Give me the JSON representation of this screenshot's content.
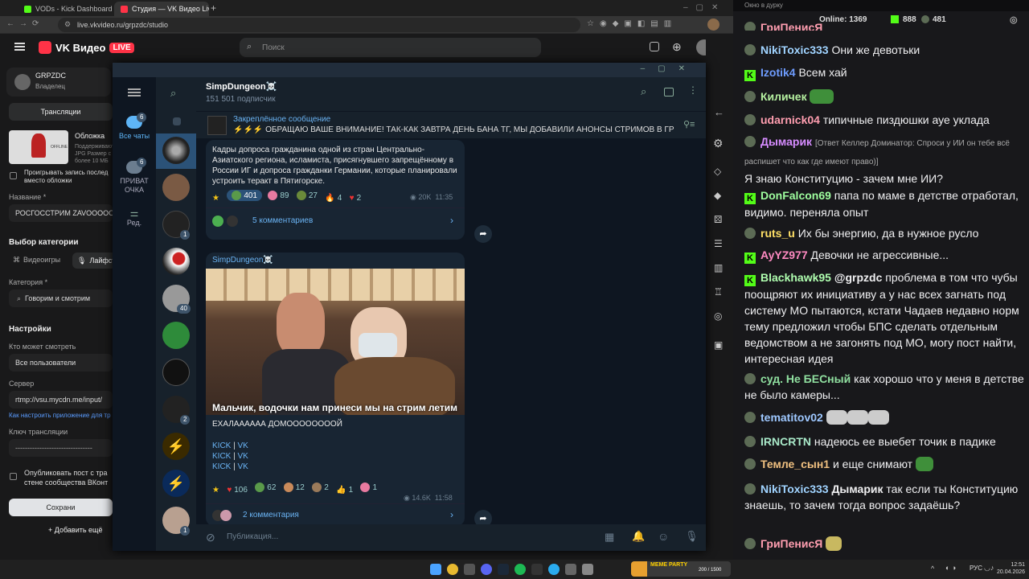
{
  "browser": {
    "tabs": [
      {
        "label": "VODs - Kick Dashboard",
        "color": "#53fc18"
      },
      {
        "label": "Студия — VK Видео Live",
        "color": "#ff3347"
      }
    ],
    "url": "live.vkvideo.ru/grpzdc/studio"
  },
  "vk": {
    "logo": "VK Видео",
    "live_badge": "LIVE",
    "search_placeholder": "Поиск",
    "user_name": "GRPZDC",
    "user_role": "Владелец",
    "nav_broadcasts": "Трансляции",
    "cover_label": "Обложка",
    "cover_hint_1": "Поддерживаются",
    "cover_hint_2": "JPG Размер с",
    "cover_hint_3": "более 10 МБ",
    "cover_tag": "OFFLINE",
    "replay_label": "Проигрывать запись послед",
    "replay_label_2": "вместо обложки",
    "name_label": "Название *",
    "name_value": "РОСГОССТРИМ ZAVOOOOO2",
    "category_section": "Выбор категории",
    "cat_games": "Видеоигры",
    "cat_life": "Лайфст",
    "category_label": "Категория *",
    "category_value": "Говорим и смотрим",
    "settings_section": "Настройки",
    "who_can_watch": "Кто может смотреть",
    "who_value": "Все пользователи",
    "server_label": "Сервер",
    "server_value": "rtmp://vsu.mycdn.me/input/",
    "howto_link": "Как настроить приложение для тр",
    "key_label": "Ключ трансляции",
    "key_value": "--------------------------------",
    "publish_label": "Опубликовать пост с тра",
    "publish_label_2": "стене сообщества ВКонт",
    "save_button": "Сохрани",
    "add_button": "Добавить ещё"
  },
  "tg": {
    "channel": "SimpDungeon☠️",
    "subscribers": "151 501 подписчик",
    "folders": [
      {
        "label": "Все чаты",
        "badge": "6"
      },
      {
        "label": "ПРИВАТ ОЧКА",
        "badge": "6"
      },
      {
        "label": "Ред.",
        "badge": ""
      }
    ],
    "chat_badges": [
      "1",
      "40",
      "2",
      "1"
    ],
    "pinned_title": "Закреплённое сообщение",
    "pinned_text": "⚡⚡⚡ ОБРАЩАЮ ВАШЕ ВНИМАНИЕ!  ТАК-КАК ЗАВТРА ДЕНЬ БАНА ТГ, МЫ ДОБАВИЛИ АНОНСЫ СТРИМОВ В ГРУП...",
    "post1": {
      "text": "Кадры допроса гражданина одной из стран Центрально-Азиатского региона, исламиста, присягнувшего запрещённому в России ИГ и допроса гражданки Германии, которые планировали устроить теракт в Пятигорске.",
      "reactions": [
        "401",
        "89",
        "27",
        "4",
        "2"
      ],
      "views": "20K",
      "time": "11:35",
      "comments": "5 комментариев"
    },
    "post2": {
      "author": "SimpDungeon☠️",
      "caption": "Мальчик, водочки нам принеси  мы на стрим летим",
      "text": "ЕХАЛАААААА ДОМООООООООЙ",
      "links": [
        "KICK",
        "VK",
        "KICK",
        "VK",
        "KICK",
        "VK"
      ],
      "reactions": [
        "106",
        "62",
        "12",
        "2",
        "1",
        "1"
      ],
      "views": "14.6K",
      "time": "11:58",
      "comments": "2 комментария"
    },
    "composer_placeholder": "Публикация..."
  },
  "chat": {
    "window_title": "Окно в дурку",
    "online": "Online: 1369",
    "kick_count": "888",
    "vk_count": "481",
    "messages": [
      {
        "name": "ГриПенисЯ",
        "color": "#fff",
        "text": "[partially visible]"
      },
      {
        "name": "NikiToxic333",
        "color": "#a0d3ff",
        "text": "Они же девотьки"
      },
      {
        "name": "Izotik4",
        "color": "#6e9cff",
        "text": "Всем хай"
      },
      {
        "name": "Киличек",
        "color": "#b5f0a0",
        "text": ""
      },
      {
        "name": "udarnick04",
        "color": "#ff9eb0",
        "text": "типичные пиздюшки ауе уклада"
      },
      {
        "name": "Дымарик",
        "color": "#d68cff",
        "reply": "[Ответ Келлер Доминатор: Спроси у ИИ он тебе всё распишет что как где имеют право)]",
        "text": "Я знаю Конституцию - зачем мне ИИ?"
      },
      {
        "name": "DonFalcon69",
        "color": "#9fff9f",
        "text": "папа по маме в детстве отработал, видимо. переняла опыт"
      },
      {
        "name": "ruts_u",
        "color": "#ffe066",
        "text": "Их бы энергию, да в нужное русло"
      },
      {
        "name": "AyYZ977",
        "color": "#ff8ac2",
        "text": "Девочки не агрессивные..."
      },
      {
        "name": "Blackhawk95",
        "color": "#b0ffb0",
        "mention": "@grpzdc",
        "text": "проблема в том что чубы поощряют их инициативу а у нас всех загнать под систему МО пытаются, кстати Чадаев недавно норм тему предложил чтобы БПС сделать отдельным ведомством а не загонять под МО, могу пост найти, интересная идея"
      },
      {
        "name": "суд. Не БЕСный",
        "color": "#90e0a0",
        "text": "как хорошо что у меня в детстве не было камеры..."
      },
      {
        "name": "tematitov02",
        "color": "#9ec8ff",
        "text": ""
      },
      {
        "name": "IRNCRTN",
        "color": "#a8e8c8",
        "text": "надеюсь ее выебет точик в падике"
      },
      {
        "name": "Темле_сын1",
        "color": "#f0c080",
        "text": "и еще снимают"
      },
      {
        "name": "NikiToxic333",
        "color": "#a0d3ff",
        "mention": "Дымарик",
        "text": "так если ты Конституцию знаешь, то зачем тогда вопрос задаёшь?"
      },
      {
        "name": "ГриПенисЯ",
        "color": "#ff9eb0",
        "text": ""
      }
    ]
  },
  "taskbar": {
    "lang": "РУС",
    "time": "12:51",
    "date": "20.04.2026",
    "overlay_name": "MEME PARTY",
    "overlay_count": "200 / 1500"
  }
}
